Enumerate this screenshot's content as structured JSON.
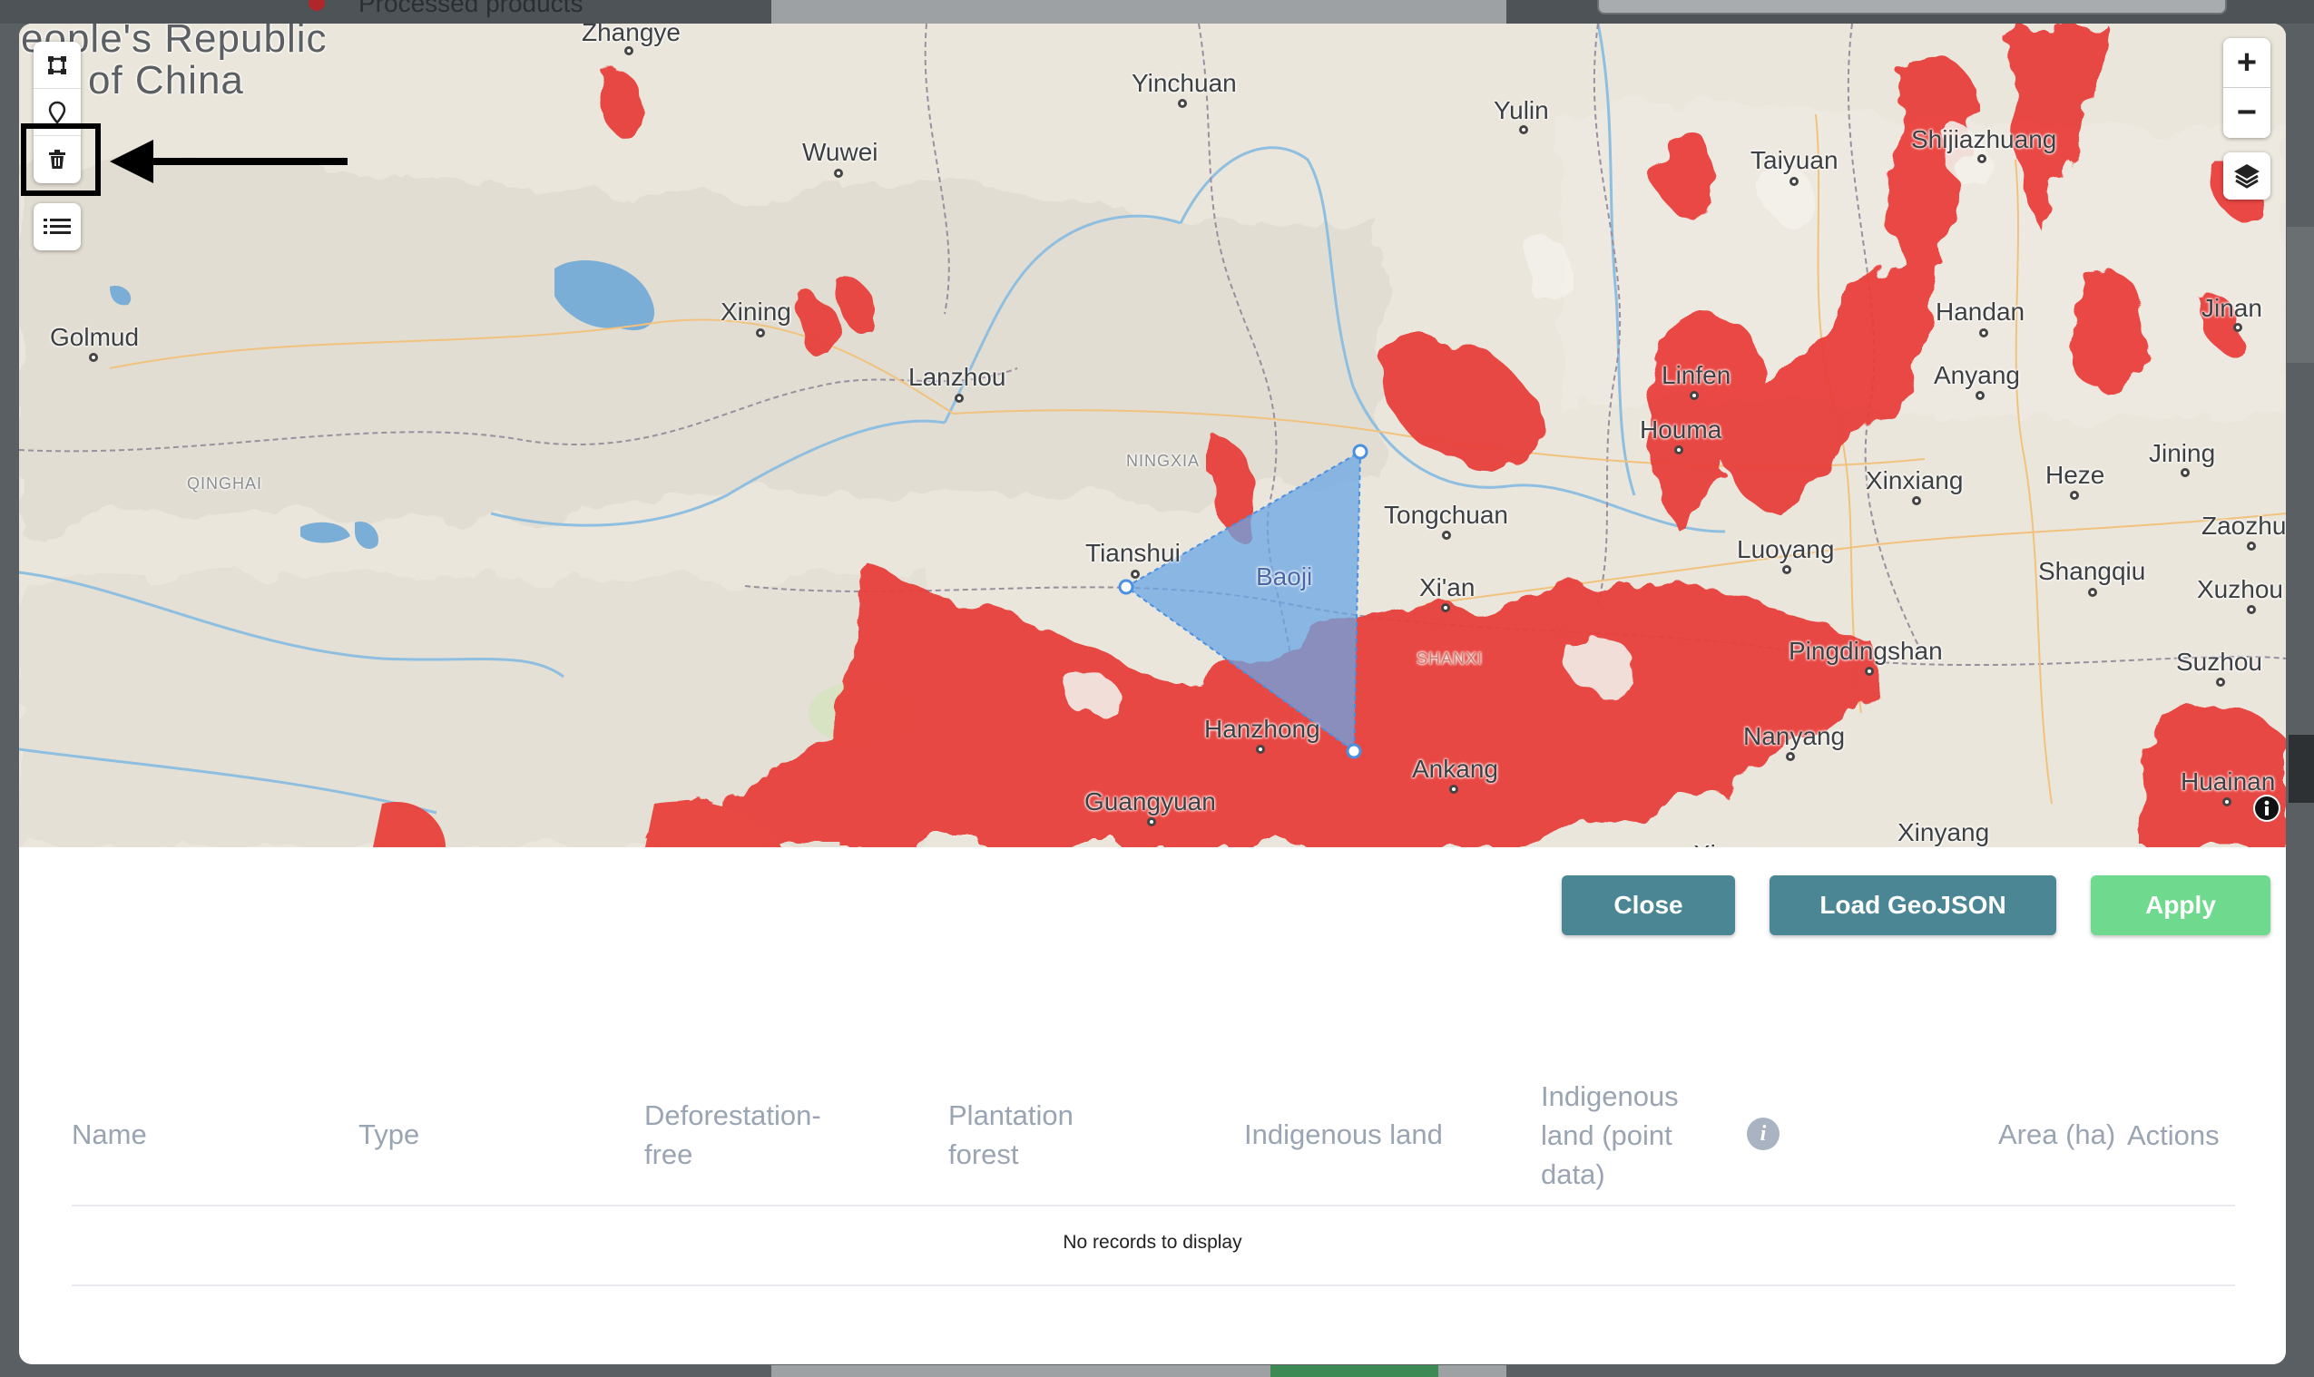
{
  "background": {
    "partial_title": "Processed products"
  },
  "map": {
    "country_label_line1": "eople's Republic",
    "country_label_line2": "of China",
    "regions": [
      "QINGHAI",
      "NINGXIA",
      "SHANXI"
    ],
    "cities": [
      "Zhangye",
      "Yinchuan",
      "Yulin",
      "Wuwei",
      "Taiyuan",
      "Shijiazhuang",
      "Xining",
      "Golmud",
      "Lanzhou",
      "Handan",
      "Jinan",
      "Linfen",
      "Anyang",
      "Houma",
      "Jining",
      "Xinxiang",
      "Heze",
      "Tongchuan",
      "Luoyang",
      "Zaozhuang",
      "Tianshui",
      "Baoji",
      "Xi'an",
      "Shangqiu",
      "Xuzhou",
      "Pingdingshan",
      "Suzhou",
      "Hanzhong",
      "Nanyang",
      "Ankang",
      "Huainan",
      "Guangyuan",
      "Xinyang",
      "Xiangyang"
    ],
    "controls": {
      "zoom_in": "+",
      "zoom_out": "−",
      "tools": [
        "draw-polygon-icon",
        "marker-icon",
        "trash-icon",
        "list-icon",
        "layers-icon",
        "info-icon"
      ]
    },
    "colors": {
      "overlay_red": "#e8413a",
      "polygon_fill": "#6aa5e6",
      "water": "#7aaed6"
    }
  },
  "buttons": {
    "close": "Close",
    "load_geojson": "Load GeoJSON",
    "apply": "Apply"
  },
  "table": {
    "headers": {
      "name": "Name",
      "type": "Type",
      "deforestation_free": "Deforestation-\nfree",
      "plantation_forest": "Plantation\nforest",
      "indigenous_land": "Indigenous land",
      "indigenous_land_point": "Indigenous\nland (point\ndata)",
      "area": "Area (ha)",
      "actions": "Actions"
    },
    "info_glyph": "i",
    "empty_message": "No records to display"
  },
  "colors": {
    "button_teal": "#4a8694",
    "button_green": "#6fd98d",
    "header_text": "#9aa4b2"
  }
}
